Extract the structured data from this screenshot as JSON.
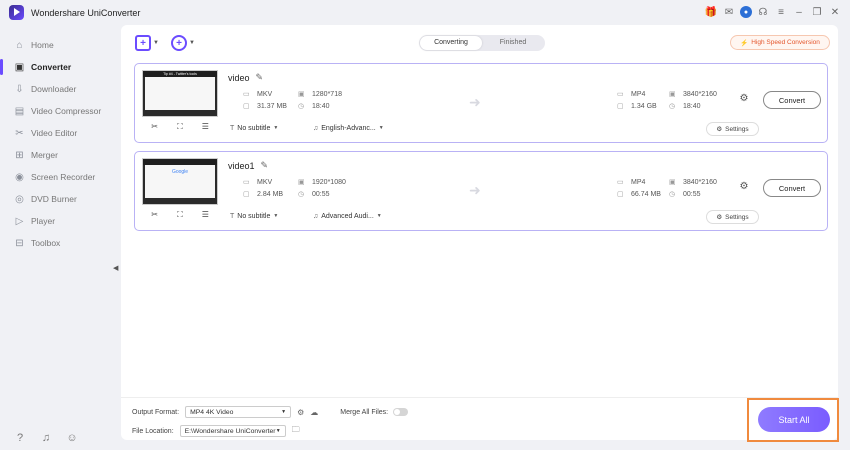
{
  "app": {
    "title": "Wondershare UniConverter"
  },
  "colors": {
    "accent": "#6b4cff",
    "card_border": "#b9b2f5",
    "highlight_outline": "#f08a3e",
    "high_speed": "#e4572e"
  },
  "window_icons": [
    "gift-icon",
    "bell-icon",
    "avatar-icon",
    "headset-icon",
    "menu-icon",
    "minimize-icon",
    "restore-icon",
    "close-icon"
  ],
  "sidebar": {
    "items": [
      {
        "label": "Home",
        "icon": "home-icon"
      },
      {
        "label": "Converter",
        "icon": "converter-icon",
        "active": true
      },
      {
        "label": "Downloader",
        "icon": "download-icon"
      },
      {
        "label": "Video Compressor",
        "icon": "compress-icon"
      },
      {
        "label": "Video Editor",
        "icon": "edit-icon"
      },
      {
        "label": "Merger",
        "icon": "merge-icon"
      },
      {
        "label": "Screen Recorder",
        "icon": "record-icon"
      },
      {
        "label": "DVD Burner",
        "icon": "disc-icon"
      },
      {
        "label": "Player",
        "icon": "play-icon"
      },
      {
        "label": "Toolbox",
        "icon": "grid-icon"
      }
    ],
    "footer_icons": [
      "help-icon",
      "notification-icon",
      "feedback-icon"
    ]
  },
  "tabs": {
    "converting": "Converting",
    "finished": "Finished"
  },
  "high_speed": {
    "label": "High Speed Conversion"
  },
  "files": [
    {
      "name": "video",
      "thumb_caption": "Tip #4 - Twitter's tools",
      "src_format": "MKV",
      "src_resolution": "1280*718",
      "src_size": "31.37 MB",
      "src_duration": "18:40",
      "dst_format": "MP4",
      "dst_resolution": "3840*2160",
      "dst_size": "1.34 GB",
      "dst_duration": "18:40",
      "subtitle": "No subtitle",
      "audio": "English-Advanc...",
      "settings_label": "Settings",
      "convert_label": "Convert"
    },
    {
      "name": "video1",
      "thumb_caption": "Google",
      "src_format": "MKV",
      "src_resolution": "1920*1080",
      "src_size": "2.84 MB",
      "src_duration": "00:55",
      "dst_format": "MP4",
      "dst_resolution": "3840*2160",
      "dst_size": "66.74 MB",
      "dst_duration": "00:55",
      "subtitle": "No subtitle",
      "audio": "Advanced Audi...",
      "settings_label": "Settings",
      "convert_label": "Convert"
    }
  ],
  "bottom": {
    "output_format_label": "Output Format:",
    "output_format_value": "MP4 4K Video",
    "merge_label": "Merge All Files:",
    "file_location_label": "File Location:",
    "file_location_value": "E:\\Wondershare UniConverter 1",
    "start_all_label": "Start All"
  }
}
